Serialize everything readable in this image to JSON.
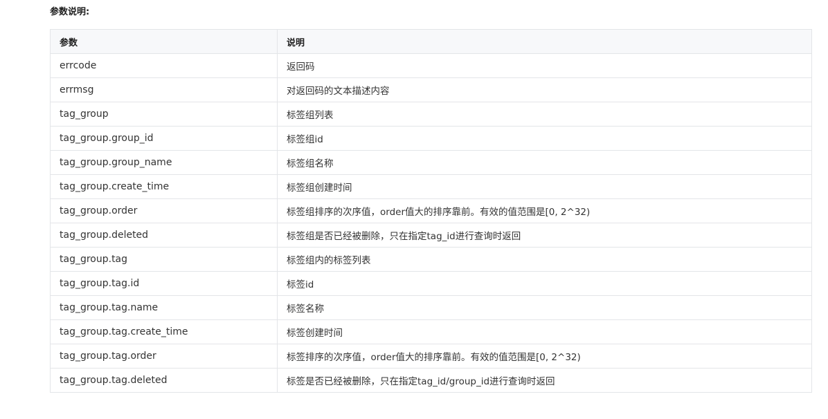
{
  "section_title": "参数说明:",
  "table": {
    "headers": [
      "参数",
      "说明"
    ],
    "rows": [
      [
        "errcode",
        "返回码"
      ],
      [
        "errmsg",
        "对返回码的文本描述内容"
      ],
      [
        "tag_group",
        "标签组列表"
      ],
      [
        "tag_group.group_id",
        "标签组id"
      ],
      [
        "tag_group.group_name",
        "标签组名称"
      ],
      [
        "tag_group.create_time",
        "标签组创建时间"
      ],
      [
        "tag_group.order",
        "标签组排序的次序值，order值大的排序靠前。有效的值范围是[0, 2^32)"
      ],
      [
        "tag_group.deleted",
        "标签组是否已经被删除，只在指定tag_id进行查询时返回"
      ],
      [
        "tag_group.tag",
        "标签组内的标签列表"
      ],
      [
        "tag_group.tag.id",
        "标签id"
      ],
      [
        "tag_group.tag.name",
        "标签名称"
      ],
      [
        "tag_group.tag.create_time",
        "标签创建时间"
      ],
      [
        "tag_group.tag.order",
        "标签排序的次序值，order值大的排序靠前。有效的值范围是[0, 2^32)"
      ],
      [
        "tag_group.tag.deleted",
        "标签是否已经被删除，只在指定tag_id/group_id进行查询时返回"
      ]
    ]
  }
}
